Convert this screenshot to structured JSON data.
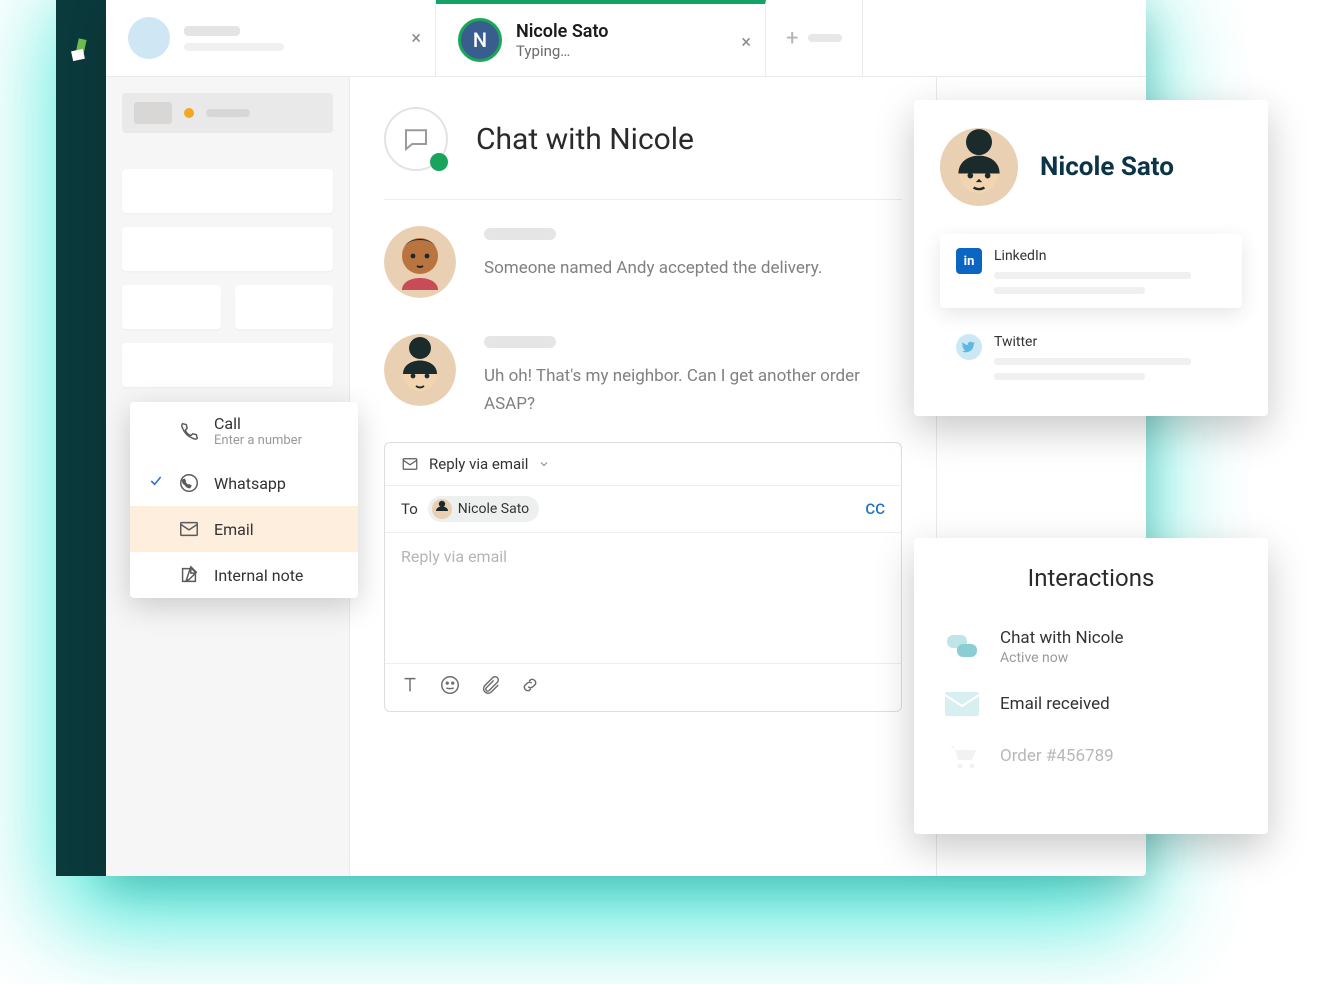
{
  "tabs": {
    "inactive_close": "×",
    "active": {
      "initial": "N",
      "title": "Nicole Sato",
      "subtitle": "Typing…",
      "close": "×"
    },
    "new_plus": "+"
  },
  "chat": {
    "title": "Chat with Nicole",
    "messages": [
      {
        "text": "Someone named Andy accepted the delivery."
      },
      {
        "text": "Uh oh! That's my neighbor. Can I get another order ASAP?"
      }
    ]
  },
  "composer": {
    "reply_label": "Reply via email",
    "to_label": "To",
    "chip_name": "Nicole Sato",
    "cc": "CC",
    "placeholder": "Reply via email"
  },
  "dropdown": {
    "call": {
      "label": "Call",
      "sub": "Enter a number"
    },
    "whatsapp": {
      "label": "Whatsapp"
    },
    "email": {
      "label": "Email"
    },
    "note": {
      "label": "Internal note"
    }
  },
  "profile": {
    "name": "Nicole Sato",
    "linkedin": "LinkedIn",
    "twitter": "Twitter"
  },
  "interactions": {
    "title": "Interactions",
    "i1": {
      "l1": "Chat with Nicole",
      "l2": "Active now"
    },
    "i2": {
      "l1": "Email received"
    },
    "i3": {
      "l1": "Order #456789"
    }
  }
}
